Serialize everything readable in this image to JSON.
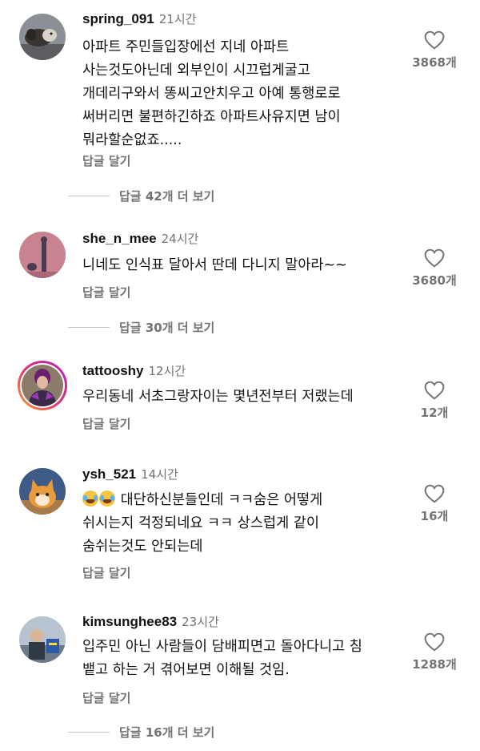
{
  "comments": [
    {
      "username": "spring_091",
      "time": "21시간",
      "text": "아파트 주민들입장에선 지네 아파트\n사는것도아닌데 외부인이 시끄럽게굴고\n개데리구와서 똥씨고안치우고 아예 통행로로\n써버리면 불편하긴하죠 아파트사유지면 남이\n뭐라할순없죠.....",
      "reply_label": "답글 달기",
      "likes": "3868개",
      "more_replies": "답글 42개 더 보기"
    },
    {
      "username": "she_n_mee",
      "time": "24시간",
      "text": "니네도 인식표 달아서 딴데 다니지 말아라~~",
      "reply_label": "답글 달기",
      "likes": "3680개",
      "more_replies": "답글 30개 더 보기"
    },
    {
      "username": "tattooshy",
      "time": "12시간",
      "text": "우리동네 서초그랑자이는 몇년전부터 저랬는데",
      "reply_label": "답글 달기",
      "likes": "12개"
    },
    {
      "username": "ysh_521",
      "time": "14시간",
      "text_first": " 대단하신분들인데 ㅋㅋ숨은 어떻게",
      "text_rest": "쉬시는지 걱정되네요 ㅋㅋ 상스럽게 같이\n숨쉬는것도 안되는데",
      "reply_label": "답글 달기",
      "likes": "16개"
    },
    {
      "username": "kimsunghee83",
      "time": "23시간",
      "text": "입주민 아닌 사람들이 담배피면고 돌아다니고 침\n뱉고 하는 거 겪어보면 이해될 것임.",
      "reply_label": "답글 달기",
      "likes": "1288개",
      "more_replies": "답글 16개 더 보기"
    }
  ],
  "icons": {
    "like": "heart-outline-icon",
    "emoji": "face-with-tears-of-joy-icon"
  },
  "colors": {
    "secondary_text": "#737373",
    "primary_text": "#111111"
  }
}
